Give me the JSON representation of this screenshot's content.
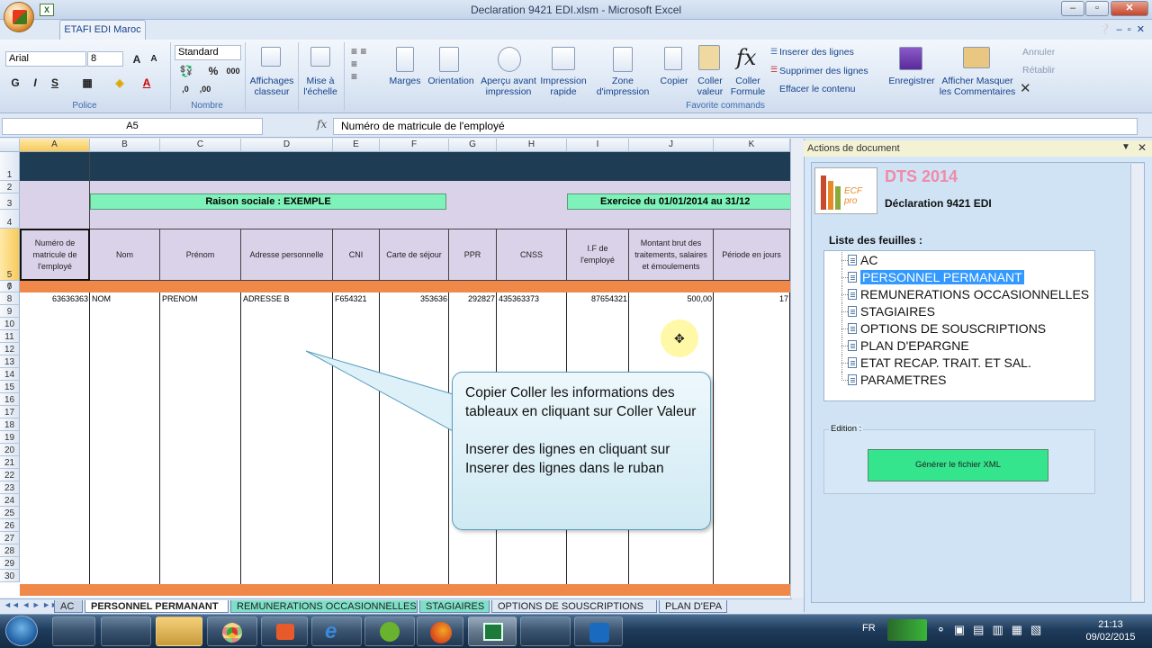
{
  "window": {
    "title": "Declaration 9421 EDI.xlsm - Microsoft Excel",
    "tab_active": "ETAFI EDI Maroc",
    "minimize": "–",
    "restore": "▫",
    "close": "✕"
  },
  "ribbon": {
    "font_name": "Arial",
    "font_size": "8",
    "number_format": "Standard",
    "group_police": "Police",
    "group_nombre": "Nombre",
    "group_favorite": "Favorite commands",
    "affichages_classeur": "Affichages classeur",
    "mise_echelle": "Mise à l'échelle",
    "marges": "Marges",
    "orientation": "Orientation",
    "apercu": "Aperçu avant impression",
    "impression_rapide": "Impression rapide",
    "zone_impression": "Zone d'impression",
    "copier": "Copier",
    "coller_valeur": "Coller valeur",
    "coller_formule": "Coller Formule",
    "inserer_lignes": "Inserer des lignes",
    "supprimer_lignes": "Supprimer des lignes",
    "effacer_contenu": "Effacer le contenu",
    "enregistrer": "Enregistrer",
    "afficher_masquer": "Afficher Masquer les Commentaires",
    "annuler": "Annuler",
    "retablir": "Rétablir",
    "bold": "G",
    "italic": "I",
    "underline": "S",
    "percent": "%",
    "thousands": "000"
  },
  "formula_bar": {
    "name_box": "A5",
    "fx": "fx",
    "value": "Numéro de matricule de l'employé"
  },
  "columns": [
    "A",
    "B",
    "C",
    "D",
    "E",
    "F",
    "G",
    "H",
    "I",
    "J",
    "K"
  ],
  "rows": [
    "1",
    "2",
    "3",
    "4",
    "5",
    "6",
    "7",
    "8",
    "9",
    "10",
    "11",
    "12",
    "13",
    "14",
    "15",
    "16",
    "17",
    "18",
    "19",
    "20",
    "21",
    "22",
    "23",
    "24",
    "25",
    "26",
    "27",
    "28",
    "29",
    "30"
  ],
  "sheet": {
    "raison_sociale": "Raison sociale : EXEMPLE",
    "exercice": "Exercice du 01/01/2014 au 31/12",
    "headers": [
      "Numéro de matricule de l'employé",
      "Nom",
      "Prénom",
      "Adresse personnelle",
      "CNI",
      "Carte de séjour",
      "PPR",
      "CNSS",
      "I.F de l'employé",
      "Montant brut des traitements, salaires et émoulements",
      "Période en jours"
    ],
    "row7": [
      "63636363",
      "NOM",
      "PRENOM",
      "ADRESSE B",
      "F654321",
      "353636",
      "292827",
      "435363373",
      "87654321",
      "500,00",
      "17"
    ]
  },
  "callout": {
    "line1": "Copier Coller les informations des tableaux en cliquant sur Coller Valeur",
    "line2": "Inserer des lignes en cliquant sur Inserer des lignes dans le ruban"
  },
  "panel": {
    "header": "Actions de document",
    "logo_text": "ECF pro",
    "app_title": "DTS 2014",
    "subtitle": "Déclaration 9421 EDI",
    "liste_label": "Liste des feuilles :",
    "feuilles": [
      "AC",
      "PERSONNEL PERMANANT",
      "REMUNERATIONS OCCASIONNELLES",
      "STAGIAIRES",
      "OPTIONS DE SOUSCRIPTIONS",
      "PLAN D'EPARGNE",
      "ETAT RECAP. TRAIT. ET SAL.",
      "PARAMETRES"
    ],
    "selected_index": 1,
    "edition_label": "Edition :",
    "generate_button": "Générer le fichier XML"
  },
  "sheet_tabs": [
    "AC",
    "PERSONNEL PERMANANT",
    "REMUNERATIONS OCCASIONNELLES",
    "STAGIAIRES",
    "OPTIONS DE SOUSCRIPTIONS",
    "PLAN D'EPA"
  ],
  "taskbar": {
    "lang": "FR",
    "time": "21:13",
    "date": "09/02/2015"
  },
  "colors": {
    "dark_band": "#1e3d55",
    "lavender": "#d9d2e9",
    "green_label": "#7ef2b8",
    "orange_band": "#f0884a",
    "accent": "#15428b"
  }
}
